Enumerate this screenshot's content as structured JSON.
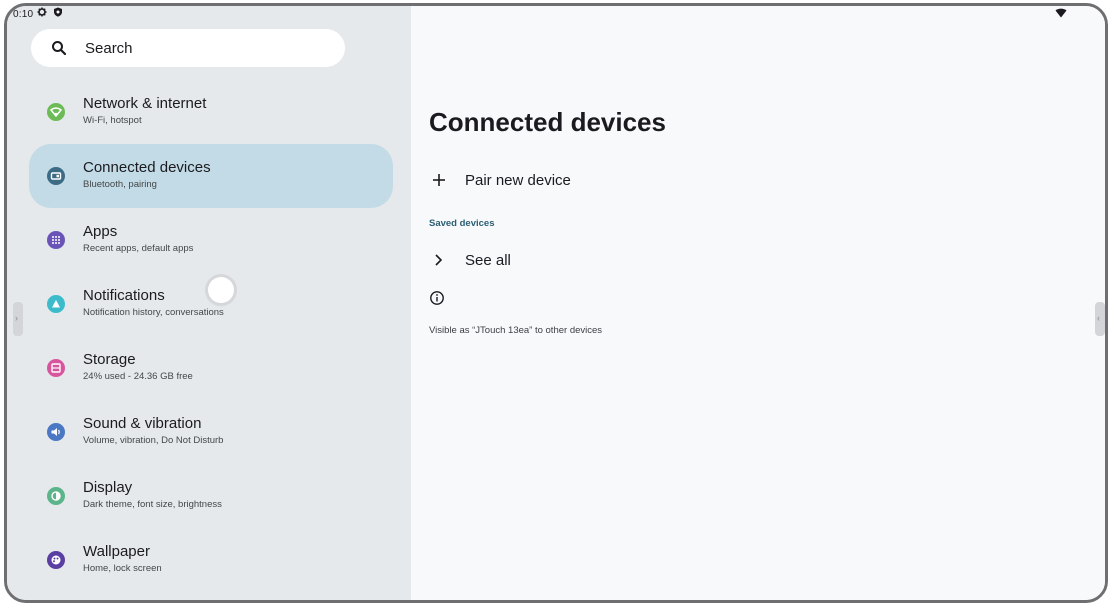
{
  "status_bar": {
    "time": "0:10"
  },
  "search": {
    "label": "Search"
  },
  "nav": [
    {
      "title": "Network & internet",
      "subtitle": "Wi-Fi, hotspot",
      "color": "#6cbb56",
      "active": false
    },
    {
      "title": "Connected devices",
      "subtitle": "Bluetooth, pairing",
      "color": "#3c6b86",
      "active": true
    },
    {
      "title": "Apps",
      "subtitle": "Recent apps, default apps",
      "color": "#6a54b8",
      "active": false
    },
    {
      "title": "Notifications",
      "subtitle": "Notification history, conversations",
      "color": "#3cbccb",
      "active": false
    },
    {
      "title": "Storage",
      "subtitle": "24% used - 24.36 GB free",
      "color": "#d8559e",
      "active": false
    },
    {
      "title": "Sound & vibration",
      "subtitle": "Volume, vibration, Do Not Disturb",
      "color": "#4a78c4",
      "active": false
    },
    {
      "title": "Display",
      "subtitle": "Dark theme, font size, brightness",
      "color": "#5cb48a",
      "active": false
    },
    {
      "title": "Wallpaper",
      "subtitle": "Home, lock screen",
      "color": "#5a3fa3",
      "active": false
    }
  ],
  "main": {
    "title": "Connected devices",
    "pair_new_device": "Pair new device",
    "saved_devices_header": "Saved devices",
    "see_all": "See all",
    "visible_as": "Visible as “JTouch 13ea” to other devices"
  },
  "colors": {
    "left_pane_bg": "#e6e9ec",
    "active_item_bg": "#c2dbe6",
    "accent": "#2c5f73"
  }
}
